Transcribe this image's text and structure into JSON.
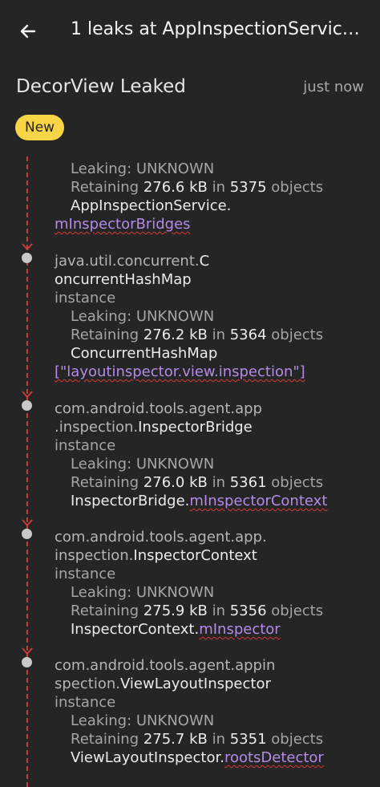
{
  "appbar": {
    "title": "1 leaks at AppInspectionServic…",
    "back_icon": "arrow-left-icon"
  },
  "header": {
    "title": "DecorView Leaked",
    "timestamp": "just now"
  },
  "badge": {
    "label": "New"
  },
  "colors": {
    "background": "#252525",
    "badge": "#f7d547",
    "trace_line": "#cc3b3b",
    "field": "#b48ae6",
    "underline": "#d93838"
  },
  "nodes": [
    {
      "leaking_label": "Leaking: ",
      "leaking_value": "UNKNOWN",
      "ret_label": "Retaining ",
      "ret_size": "276.6 kB",
      "ret_in": " in ",
      "ret_count": "5375",
      "ret_objects": " objects",
      "ref_owner": "AppInspectionService.",
      "ref_field": "mInspectorBridges"
    },
    {
      "class_prefix": "java.util.concurrent.",
      "class_prefix_2": "",
      "class_name_1": "C",
      "class_name_2": "oncurrentHashMap",
      "kind": "instance",
      "leaking_label": "Leaking: ",
      "leaking_value": "UNKNOWN",
      "ret_label": "Retaining ",
      "ret_size": "276.2 kB",
      "ret_in": " in ",
      "ret_count": "5364",
      "ret_objects": " objects",
      "ref_owner": "ConcurrentHashMap",
      "ref_field": "[\"layoutinspector.view.inspection\"]"
    },
    {
      "class_prefix": "com.android.tools.agent.app",
      "class_prefix_2": ".inspection.",
      "class_name_1": "",
      "class_name_2": "InspectorBridge",
      "kind": "instance",
      "leaking_label": "Leaking: ",
      "leaking_value": "UNKNOWN",
      "ret_label": "Retaining ",
      "ret_size": "276.0 kB",
      "ret_in": " in ",
      "ret_count": "5361",
      "ret_objects": " objects",
      "ref_owner": "InspectorBridge.",
      "ref_field": "mInspectorContext"
    },
    {
      "class_prefix": "com.android.tools.agent.app.",
      "class_prefix_2": "inspection.",
      "class_name_1": "",
      "class_name_2": "InspectorContext",
      "kind": "instance",
      "leaking_label": "Leaking: ",
      "leaking_value": "UNKNOWN",
      "ret_label": "Retaining ",
      "ret_size": "275.9 kB",
      "ret_in": " in ",
      "ret_count": "5356",
      "ret_objects": " objects",
      "ref_owner": "InspectorContext.",
      "ref_field": "mInspector"
    },
    {
      "class_prefix": "com.android.tools.agent.appin",
      "class_prefix_2": "spection.",
      "class_name_1": "",
      "class_name_2": "ViewLayoutInspector",
      "kind": "instance",
      "leaking_label": "Leaking: ",
      "leaking_value": "UNKNOWN",
      "ret_label": "Retaining ",
      "ret_size": "275.7 kB",
      "ret_in": " in ",
      "ret_count": "5351",
      "ret_objects": " objects",
      "ref_owner": "ViewLayoutInspector.",
      "ref_field": "rootsDetector"
    }
  ]
}
